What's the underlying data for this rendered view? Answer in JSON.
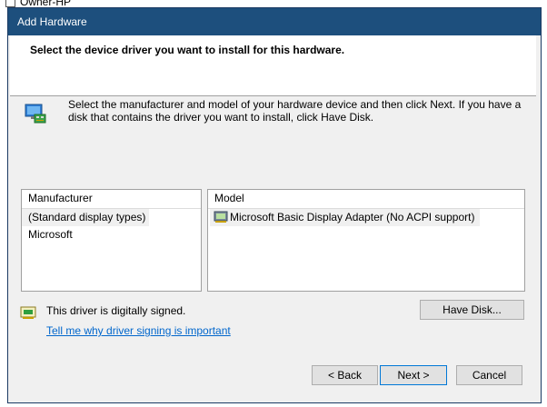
{
  "background": {
    "window_item": "Owner-HP"
  },
  "dialog": {
    "title": "Add Hardware",
    "header_title": "Select the device driver you want to install for this hardware.",
    "instructions": "Select the manufacturer and model of your hardware device and then click Next. If you have a disk that contains the driver you want to install, click Have Disk."
  },
  "manufacturer_list": {
    "header": "Manufacturer",
    "items": [
      "(Standard display types)",
      "Microsoft"
    ],
    "selected": "(Standard display types)"
  },
  "model_list": {
    "header": "Model",
    "items": [
      "Microsoft Basic Display Adapter (No ACPI support)"
    ],
    "selected": "Microsoft Basic Display Adapter (No ACPI support)"
  },
  "signing": {
    "status_text": "This driver is digitally signed.",
    "link_text": "Tell me why driver signing is important"
  },
  "buttons": {
    "have_disk": "Have Disk...",
    "back": "< Back",
    "next": "Next >",
    "cancel": "Cancel"
  },
  "icons": {
    "hardware": "hardware-wizard-icon",
    "display_adapter": "display-adapter-icon",
    "signed_driver": "signed-driver-icon"
  },
  "colors": {
    "titlebar": "#1d4f7d",
    "link": "#0066cc",
    "default_button_border": "#0078d7"
  }
}
